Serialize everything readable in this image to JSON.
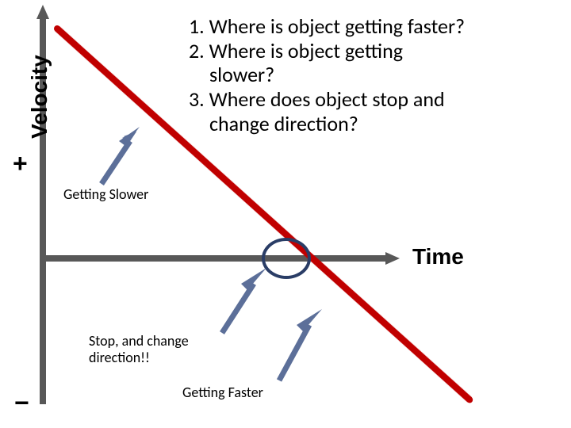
{
  "axes": {
    "y_label": "Velocity",
    "x_label": "Time",
    "plus": "+",
    "minus": "−"
  },
  "questions": {
    "l1": "1. Where is object getting faster?",
    "l2": "2. Where is object getting",
    "l3": "slower?",
    "l4": "3. Where does object stop and",
    "l5": "change direction?"
  },
  "annotations": {
    "slower": "Getting Slower",
    "stop_l1": "Stop, and change",
    "stop_l2": "direction!!",
    "faster": "Getting Faster"
  },
  "chart_data": {
    "type": "line",
    "title": "",
    "xlabel": "Time",
    "ylabel": "Velocity",
    "y_positive_label": "+",
    "y_negative_label": "−",
    "series": [
      {
        "name": "velocity",
        "x": [
          0,
          1
        ],
        "y": [
          1,
          -1
        ],
        "color": "#c00000",
        "note": "straight line, positive to negative, constant negative slope"
      }
    ],
    "annotations": [
      {
        "text": "Getting Slower",
        "region": "positive velocity segment (before x-axis crossing)"
      },
      {
        "text": "Stop, and change direction!!",
        "region": "x-axis crossing (velocity = 0)"
      },
      {
        "text": "Getting Faster",
        "region": "negative velocity segment (after x-axis crossing)"
      }
    ],
    "xlim": [
      0,
      1
    ],
    "ylim": [
      -1,
      1
    ]
  }
}
